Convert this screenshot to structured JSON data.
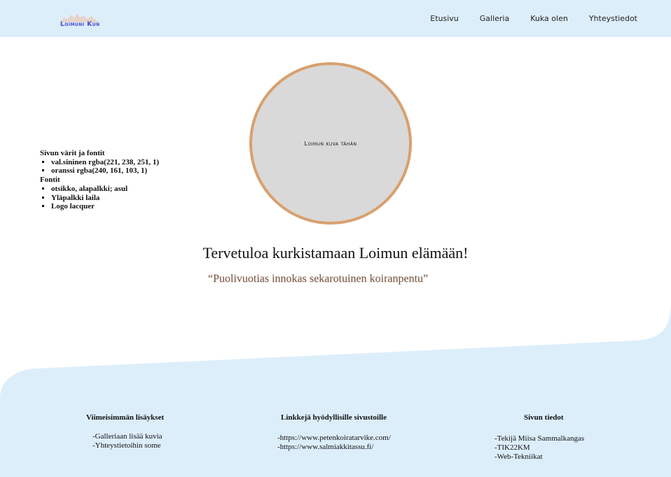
{
  "header": {
    "logo_text": "Loimuni Kun",
    "nav": [
      "Etusivu",
      "Galleria",
      "Kuka olen",
      "Yhteystiedot"
    ]
  },
  "side_info": {
    "title": "Sivun värit ja fontit",
    "colors": [
      "val.sininen rgba(221, 238, 251, 1)",
      "oranssi rgba(240, 161, 103, 1)"
    ],
    "fonts_title": "Fontit",
    "fonts": [
      "otsikko, alapalkki; asul",
      "Yläpalkki laila",
      "Logo lacquer"
    ]
  },
  "hero": {
    "image_placeholder": "Loimun kuva tähän",
    "welcome": "Tervetuloa kurkistamaan Loimun elämään!",
    "tagline": "“Puolivuotias innokas sekarotuinen koiranpentu”"
  },
  "footer": {
    "col1_title": "Viimeisimmän lisäykset",
    "col1_lines": [
      "-Galleriaan lisää kuvia",
      "-Yhteystietoihin some"
    ],
    "col2_title": "Linkkejä hyödyllisille sivustoille",
    "col2_lines": [
      "-https://www.petenkoiratarvike.com/",
      "-https://www.salmiakkitassu.fi/"
    ],
    "col3_title": "Sivun tiedot",
    "col3_lines": [
      "-Tekijä Miisa Sammalkangas",
      "-TIK22KM",
      "-Web-Tekniikat"
    ]
  },
  "colors": {
    "light_blue": "#ddeefb",
    "orange": "#f0a167"
  }
}
